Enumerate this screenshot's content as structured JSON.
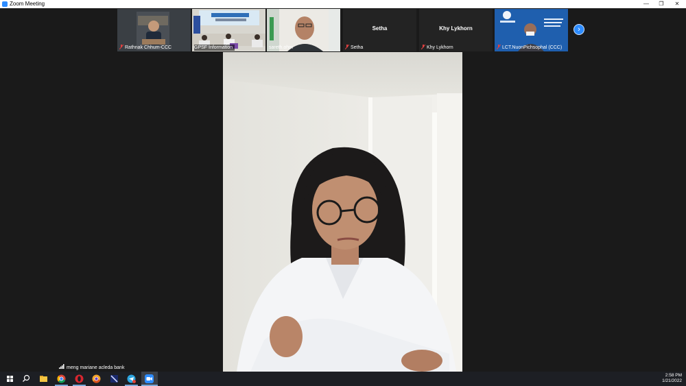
{
  "window": {
    "title": "Zoom Meeting",
    "controls": {
      "minimize": "—",
      "restore": "❐",
      "close": "✕"
    }
  },
  "participants": [
    {
      "id": "rathnak",
      "name": "Rathnak Chhum-CCC",
      "video": true,
      "muted": true
    },
    {
      "id": "gpsf",
      "name": "GPSF Information",
      "video": true,
      "muted": false
    },
    {
      "id": "sareth",
      "name": "sareth.ohm",
      "video": true,
      "muted": false
    },
    {
      "id": "setha",
      "name": "Setha",
      "video": false,
      "muted": true
    },
    {
      "id": "khy",
      "name": "Khy Lykhorn",
      "video": false,
      "muted": true
    },
    {
      "id": "nuon",
      "name": "LCT.NuonPichsophal (CCC)",
      "video": true,
      "muted": true
    }
  ],
  "next_page_button": {
    "icon": "chevron-right-icon",
    "glyph": "›"
  },
  "active_speaker": {
    "name": "meng mariane acleda bank",
    "signal_icon": "signal-bars-icon"
  },
  "taskbar": {
    "icons": [
      "windows-start-icon",
      "search-icon",
      "file-explorer-icon",
      "chrome-icon",
      "opera-icon",
      "chrome-canary-icon",
      "media-player-icon",
      "telegram-icon",
      "zoom-icon"
    ],
    "clock": {
      "time": "2:58 PM",
      "date": "1/21/2022"
    }
  },
  "colors": {
    "zoom_blue": "#2d8cff",
    "background": "#1a1a1a",
    "taskbar": "#1d1f24"
  }
}
